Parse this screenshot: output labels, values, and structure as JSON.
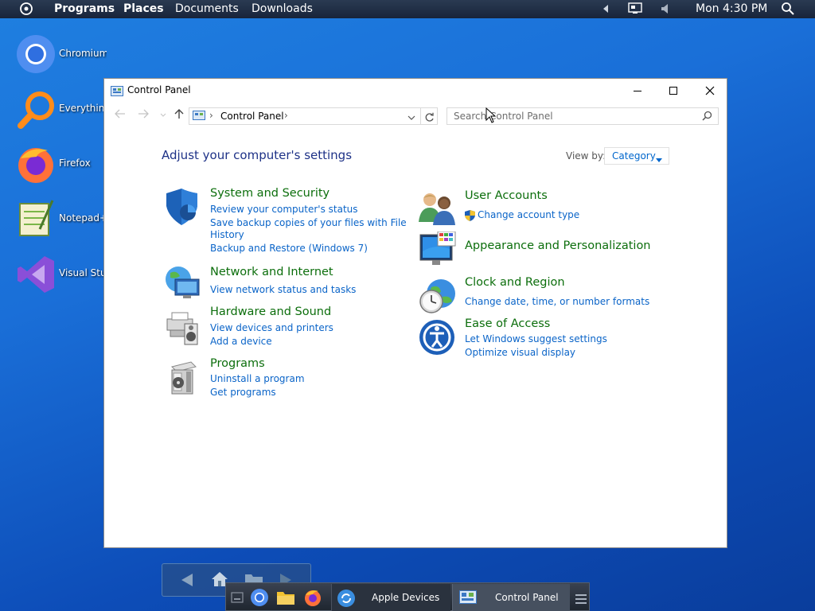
{
  "top_panel": {
    "menu": [
      "Programs",
      "Places",
      "Documents",
      "Downloads"
    ],
    "clock": "Mon 4:30 PM",
    "icons": [
      "activities-icon",
      "arrow-left-icon",
      "display-icon",
      "volume-icon",
      "search-icon"
    ]
  },
  "desktop": {
    "icons": [
      {
        "label": "Chromium",
        "icon": "chromium-icon"
      },
      {
        "label": "Everything",
        "icon": "everything-search-icon"
      },
      {
        "label": "Firefox",
        "icon": "firefox-icon"
      },
      {
        "label": "Notepad++",
        "icon": "notepad-plus-icon"
      },
      {
        "label": "Visual Studio",
        "icon": "visual-studio-icon"
      }
    ]
  },
  "window": {
    "title": "Control Panel",
    "address": {
      "crumb": "Control Panel"
    },
    "search": {
      "placeholder": "Search Control Panel"
    },
    "heading": "Adjust your computer's settings",
    "view_by": {
      "label": "View by:",
      "value": "Category"
    },
    "categories_left": [
      {
        "title": "System and Security",
        "links": [
          "Review your computer's status",
          "Save backup copies of your files with File",
          "History",
          "Backup and Restore (Windows 7)"
        ],
        "icon": "shield-icon"
      },
      {
        "title": "Network and Internet",
        "links": [
          "View network status and tasks"
        ],
        "icon": "network-icon"
      },
      {
        "title": "Hardware and Sound",
        "links": [
          "View devices and printers",
          "Add a device"
        ],
        "icon": "printer-speaker-icon"
      },
      {
        "title": "Programs",
        "links": [
          "Uninstall a program",
          "Get programs"
        ],
        "icon": "programs-icon"
      }
    ],
    "categories_right": [
      {
        "title": "User Accounts",
        "links": [
          "Change account type"
        ],
        "icon": "users-icon"
      },
      {
        "title": "Appearance and Personalization",
        "links": [],
        "icon": "monitor-palette-icon"
      },
      {
        "title": "Clock and Region",
        "links": [
          "Change date, time, or number formats"
        ],
        "icon": "clock-globe-icon"
      },
      {
        "title": "Ease of Access",
        "links": [
          "Let Windows suggest settings",
          "Optimize visual display"
        ],
        "icon": "ease-of-access-icon"
      }
    ]
  },
  "taskbar": {
    "tasks": [
      {
        "label": "Apple Devices",
        "icon": "sync-icon"
      },
      {
        "label": "Control Panel",
        "icon": "control-panel-icon"
      }
    ]
  }
}
